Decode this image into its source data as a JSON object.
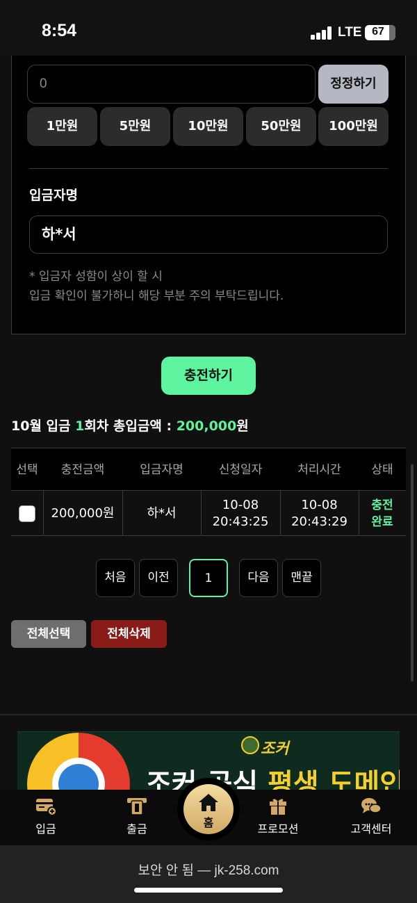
{
  "status_bar": {
    "time": "8:54",
    "network": "LTE",
    "battery": "67"
  },
  "deposit_form": {
    "amount_value": "0",
    "reset_label": "정정하기",
    "quick_amounts": [
      "1만원",
      "5만원",
      "10만원",
      "50만원",
      "100만원"
    ],
    "depositor_label": "입금자명",
    "depositor_value": "하*서",
    "notice_lines": [
      "* 입금자 성함이 상이 할 시",
      "입금 확인이 불가하니 해당 부분 주의 부탁드립니다."
    ],
    "charge_label": "충전하기"
  },
  "summary": {
    "prefix": "10월 입금 ",
    "count": "1",
    "middle": "회차 총입금액 : ",
    "total": "200,000",
    "unit": "원"
  },
  "history": {
    "columns": [
      "선택",
      "충전금액",
      "입금자명",
      "신청일자",
      "처리시간",
      "상태"
    ],
    "rows": [
      {
        "amount": "200,000원",
        "depositor": "하*서",
        "request_date": "10-08",
        "request_time": "20:43:25",
        "process_date": "10-08",
        "process_time": "20:43:29",
        "status_line1": "충전",
        "status_line2": "완료"
      }
    ]
  },
  "pagination": {
    "first": "처음",
    "prev": "이전",
    "current": "1",
    "next": "다음",
    "last": "맨끝"
  },
  "bulk_actions": {
    "select_all": "전체선택",
    "delete_all": "전체삭제"
  },
  "banner": {
    "logo": "조커",
    "headline_white": "조커 공식 ",
    "headline_yellow": "평생 도메인"
  },
  "tab_bar": {
    "items": [
      {
        "label": "입금",
        "icon": "deposit-card-icon"
      },
      {
        "label": "출금",
        "icon": "withdraw-icon"
      },
      {
        "label": "홈",
        "icon": "home-icon"
      },
      {
        "label": "프로모션",
        "icon": "gift-icon"
      },
      {
        "label": "고객센터",
        "icon": "chat-bubbles-icon"
      }
    ]
  },
  "browser": {
    "url": "보안 안 됨 — jk-258.com"
  },
  "colors": {
    "accent_green": "#5ef39f",
    "gold": "#d1a965",
    "delete_red": "#8a1c17"
  }
}
